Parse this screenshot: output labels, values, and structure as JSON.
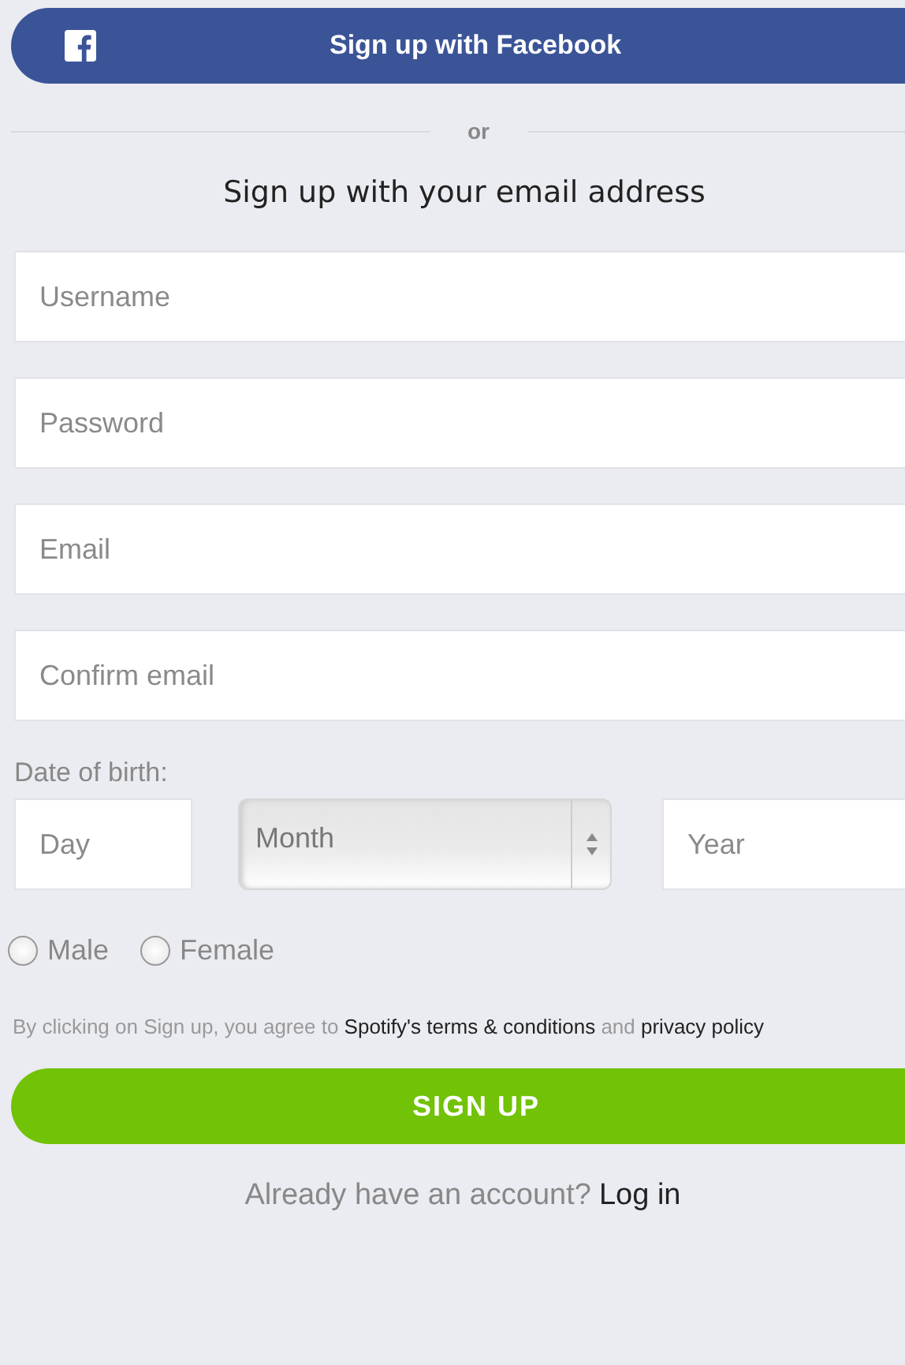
{
  "facebook_button": {
    "label": "Sign up with Facebook"
  },
  "separator": {
    "label": "or"
  },
  "heading": "Sign up with your email address",
  "fields": [
    {
      "placeholder": "Username"
    },
    {
      "placeholder": "Password"
    },
    {
      "placeholder": "Email"
    },
    {
      "placeholder": "Confirm email"
    }
  ],
  "date_of_birth": {
    "label": "Date of birth:",
    "day": {
      "placeholder": "Day"
    },
    "month": {
      "value": "Month"
    },
    "year": {
      "placeholder": "Year"
    }
  },
  "gender": [
    {
      "label": "Male",
      "selected": false
    },
    {
      "label": "Female",
      "selected": false
    }
  ],
  "terms": {
    "before": "By clicking on Sign up, you agree to ",
    "terms_link": "Spotify's terms & conditions",
    "middle": " and ",
    "privacy_link": "privacy policy"
  },
  "signup_button": {
    "label": "SIGN UP"
  },
  "login": {
    "prompt": "Already have an account?",
    "link": "Log in"
  }
}
